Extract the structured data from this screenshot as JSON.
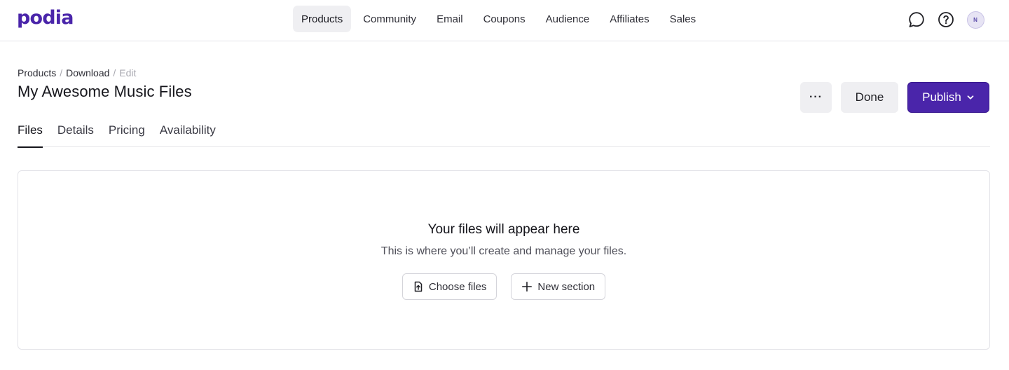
{
  "brand": {
    "logo_text": "podia",
    "color": "#4a25aa"
  },
  "nav": {
    "items": [
      {
        "label": "Products",
        "active": true
      },
      {
        "label": "Community"
      },
      {
        "label": "Email"
      },
      {
        "label": "Coupons"
      },
      {
        "label": "Audience"
      },
      {
        "label": "Affiliates"
      },
      {
        "label": "Sales"
      }
    ],
    "icons": [
      "chat-bubble-icon",
      "help-circle-icon"
    ],
    "avatar_initial": "N"
  },
  "breadcrumb": {
    "items": [
      "Products",
      "Download",
      "Edit"
    ],
    "separator": "/"
  },
  "page": {
    "title": "My Awesome Music Files"
  },
  "actions": {
    "more_label": "···",
    "done_label": "Done",
    "publish_label": "Publish",
    "publish_color": "#4a25aa"
  },
  "tabs": [
    {
      "label": "Files",
      "active": true
    },
    {
      "label": "Details"
    },
    {
      "label": "Pricing"
    },
    {
      "label": "Availability"
    }
  ],
  "empty_state": {
    "title": "Your files will appear here",
    "subtitle": "This is where you’ll create and manage your files.",
    "choose_files_label": "Choose files",
    "new_section_label": "New section"
  }
}
